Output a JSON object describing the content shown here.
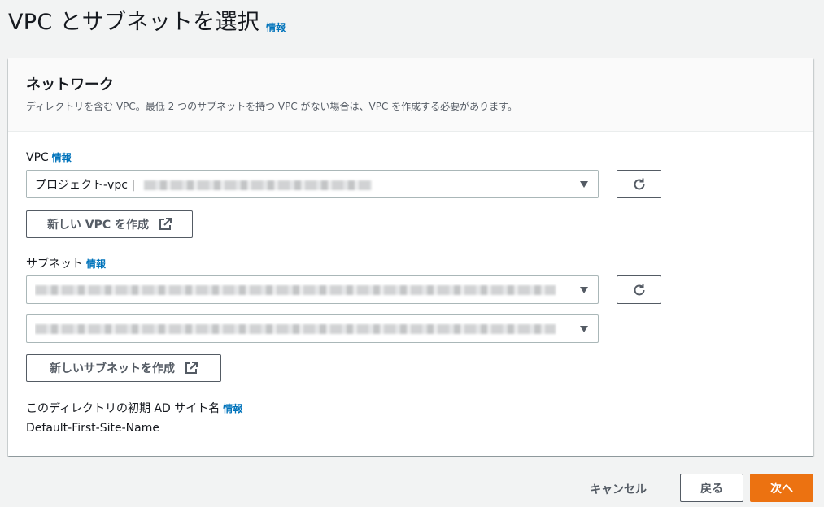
{
  "page": {
    "title": "VPC とサブネットを選択",
    "info": "情報"
  },
  "network": {
    "heading": "ネットワーク",
    "description": "ディレクトリを含む VPC。最低 2 つのサブネットを持つ VPC がない場合は、VPC を作成する必要があります。"
  },
  "vpc": {
    "label": "VPC",
    "info": "情報",
    "selected": "プロジェクト-vpc |",
    "create_button": "新しい VPC を作成"
  },
  "subnet": {
    "label": "サブネット",
    "info": "情報",
    "create_button": "新しいサブネットを作成"
  },
  "ad_site": {
    "label": "このディレクトリの初期 AD サイト名",
    "info": "情報",
    "value": "Default-First-Site-Name"
  },
  "footer": {
    "cancel": "キャンセル",
    "back": "戻る",
    "next": "次へ"
  },
  "colors": {
    "accent": "#ec7211",
    "link": "#0073bb"
  },
  "icons": [
    "refresh-icon",
    "external-link-icon",
    "caret-down-icon"
  ]
}
